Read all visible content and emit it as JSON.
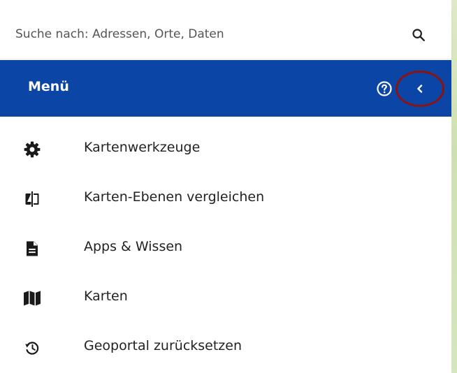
{
  "search": {
    "placeholder": "Suche nach: Adressen, Orte, Daten",
    "icon": "search-icon"
  },
  "header": {
    "title": "Menü",
    "help_icon": "help-circle-icon",
    "collapse_icon": "chevron-left-icon",
    "background": "#0b45a6",
    "highlight_color": "#8a1414"
  },
  "menu": {
    "items": [
      {
        "label": "Kartenwerkzeuge",
        "icon": "gear-icon"
      },
      {
        "label": "Karten-Ebenen vergleichen",
        "icon": "compare-layers-icon"
      },
      {
        "label": "Apps & Wissen",
        "icon": "document-icon"
      },
      {
        "label": "Karten",
        "icon": "map-icon"
      },
      {
        "label": "Geoportal zurücksetzen",
        "icon": "reset-history-icon"
      }
    ]
  }
}
